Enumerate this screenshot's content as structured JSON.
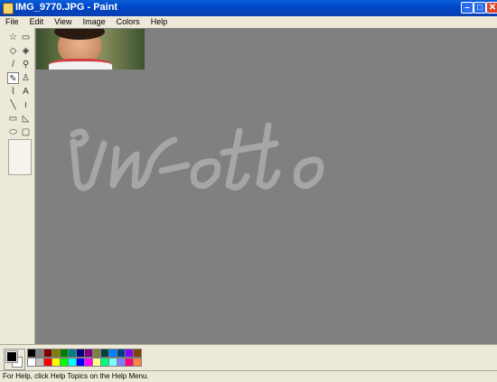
{
  "window": {
    "title": "IMG_9770.JPG - Paint",
    "minimize": "–",
    "maximize": "□",
    "close": "✕"
  },
  "menu": [
    "File",
    "Edit",
    "View",
    "Image",
    "Colors",
    "Help"
  ],
  "tools": [
    {
      "name": "free-form-select-icon",
      "glyph": "☆"
    },
    {
      "name": "select-icon",
      "glyph": "▭"
    },
    {
      "name": "eraser-icon",
      "glyph": "◇"
    },
    {
      "name": "fill-icon",
      "glyph": "◈"
    },
    {
      "name": "pick-color-icon",
      "glyph": "/"
    },
    {
      "name": "magnifier-icon",
      "glyph": "⚲"
    },
    {
      "name": "pencil-icon",
      "glyph": "✎"
    },
    {
      "name": "brush-icon",
      "glyph": "♙"
    },
    {
      "name": "airbrush-icon",
      "glyph": "⌇"
    },
    {
      "name": "text-icon",
      "glyph": "A"
    },
    {
      "name": "line-icon",
      "glyph": "╲"
    },
    {
      "name": "curve-icon",
      "glyph": "≀"
    },
    {
      "name": "rectangle-icon",
      "glyph": "▭"
    },
    {
      "name": "polygon-icon",
      "glyph": "◺"
    },
    {
      "name": "ellipse-icon",
      "glyph": "⬭"
    },
    {
      "name": "rounded-rectangle-icon",
      "glyph": "▢"
    }
  ],
  "selected_tool": "pencil-icon",
  "canvas": {
    "background": "#808080",
    "watermark_text": "โน-otto"
  },
  "colors": {
    "foreground": "#000000",
    "background": "#ffffff",
    "row1": [
      "#000000",
      "#808080",
      "#800000",
      "#808000",
      "#008000",
      "#008080",
      "#000080",
      "#800080",
      "#808040",
      "#004040",
      "#0080ff",
      "#004080",
      "#8000ff",
      "#804000"
    ],
    "row2": [
      "#ffffff",
      "#c0c0c0",
      "#ff0000",
      "#ffff00",
      "#00ff00",
      "#00ffff",
      "#0000ff",
      "#ff00ff",
      "#ffff80",
      "#00ff80",
      "#80ffff",
      "#8080ff",
      "#ff0080",
      "#ff8040"
    ]
  },
  "status": "For Help, click Help Topics on the Help Menu."
}
